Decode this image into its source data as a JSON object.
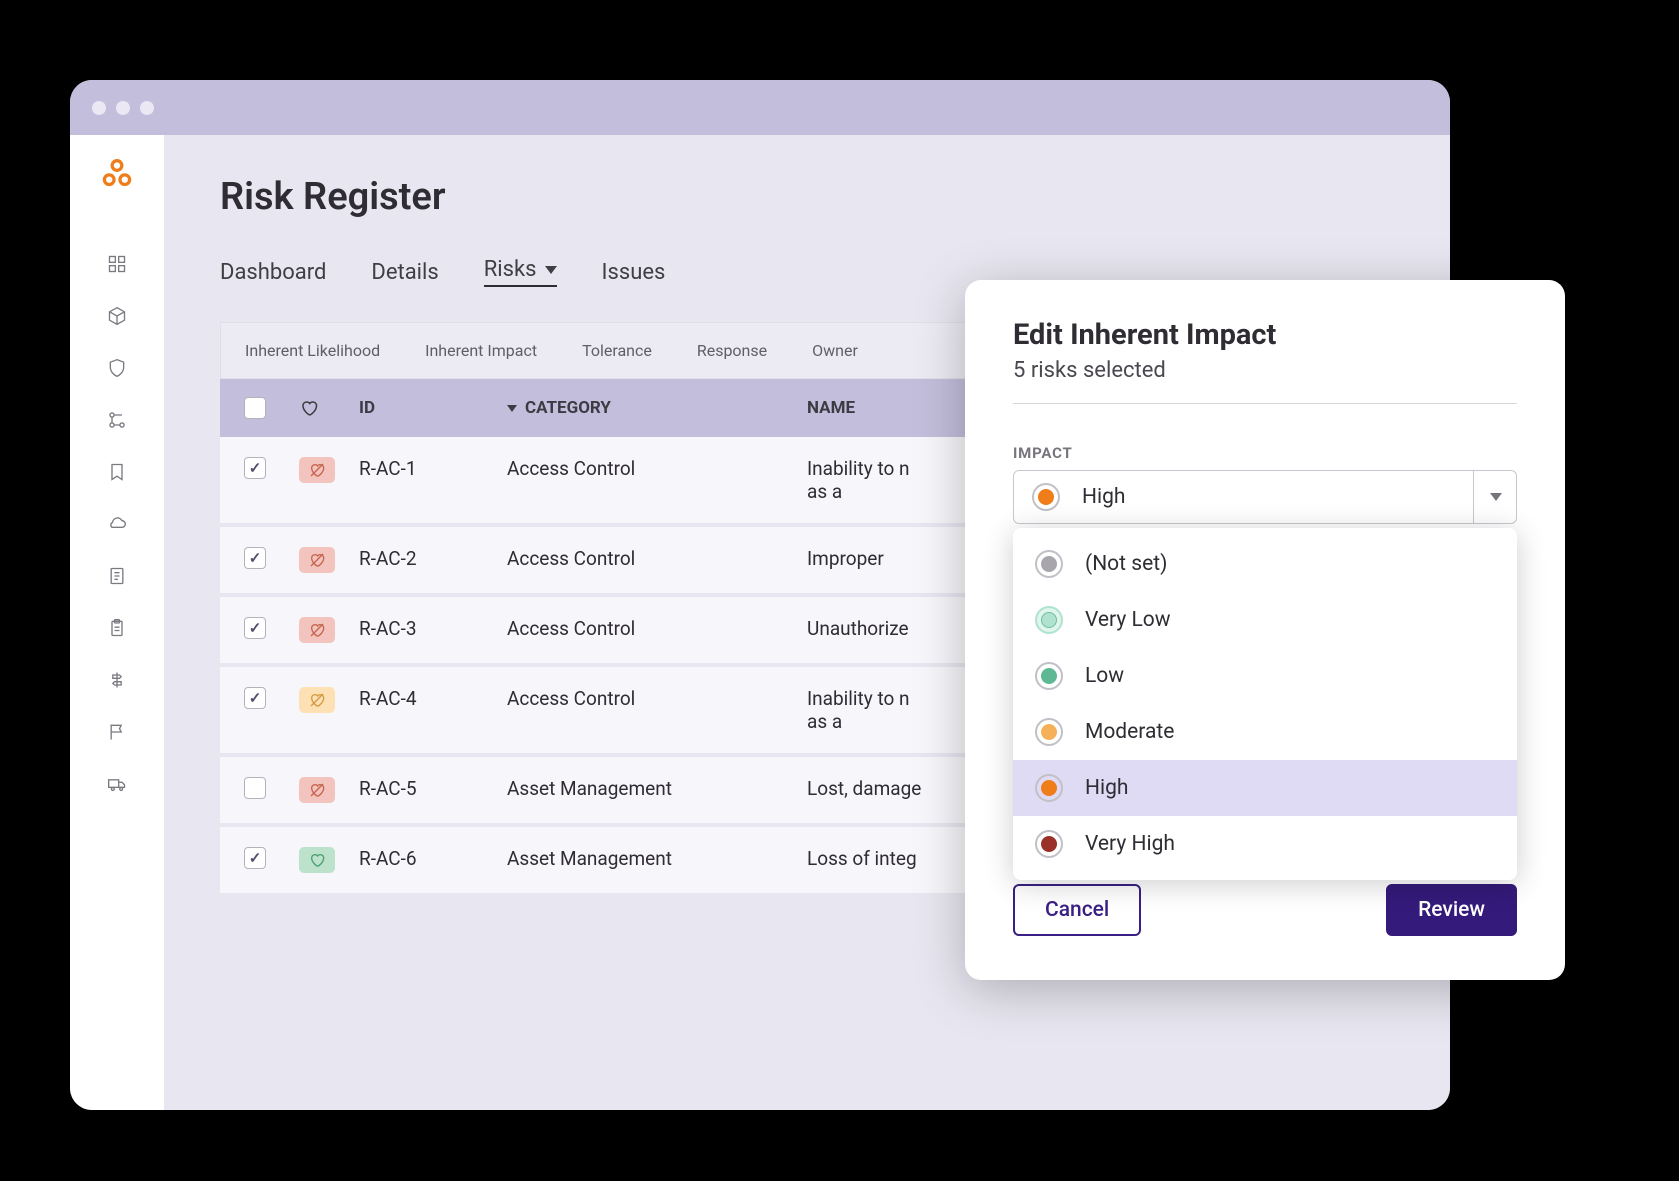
{
  "page": {
    "title": "Risk Register"
  },
  "tabs": [
    "Dashboard",
    "Details",
    "Risks",
    "Issues"
  ],
  "activeTab": "Risks",
  "filters": [
    "Inherent Likelihood",
    "Inherent Impact",
    "Tolerance",
    "Response",
    "Owner"
  ],
  "columns": {
    "id": "ID",
    "category": "CATEGORY",
    "name": "NAME"
  },
  "rows": [
    {
      "checked": true,
      "heart": "red",
      "id": "R-AC-1",
      "category": "Access Control",
      "name": "Inability to n as a"
    },
    {
      "checked": true,
      "heart": "red",
      "id": "R-AC-2",
      "category": "Access Control",
      "name": "Improper"
    },
    {
      "checked": true,
      "heart": "red",
      "id": "R-AC-3",
      "category": "Access Control",
      "name": "Unauthorize"
    },
    {
      "checked": true,
      "heart": "amber",
      "id": "R-AC-4",
      "category": "Access Control",
      "name": "Inability to n as a"
    },
    {
      "checked": false,
      "heart": "red",
      "id": "R-AC-5",
      "category": "Asset Management",
      "name": "Lost, damage"
    },
    {
      "checked": true,
      "heart": "green",
      "id": "R-AC-6",
      "category": "Asset Management",
      "name": "Loss of integ"
    }
  ],
  "modal": {
    "title": "Edit Inherent Impact",
    "subtitle": "5 risks selected",
    "fieldLabel": "IMPACT",
    "selected": "High",
    "options": [
      {
        "label": "(Not set)",
        "color": "gray"
      },
      {
        "label": "Very Low",
        "color": "teal-light"
      },
      {
        "label": "Low",
        "color": "teal"
      },
      {
        "label": "Moderate",
        "color": "amber"
      },
      {
        "label": "High",
        "color": "orange"
      },
      {
        "label": "Very High",
        "color": "darkred"
      }
    ],
    "cancel": "Cancel",
    "review": "Review"
  },
  "sidebarIcons": [
    "dashboard-icon",
    "cube-icon",
    "shield-icon",
    "network-icon",
    "bookmark-icon",
    "cloud-icon",
    "document-icon",
    "clipboard-icon",
    "signpost-icon",
    "flag-icon",
    "truck-icon"
  ]
}
